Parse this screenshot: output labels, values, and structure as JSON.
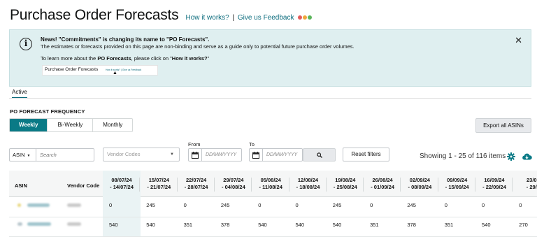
{
  "header": {
    "title": "Purchase Order Forecasts",
    "how_it_works": "How it works?",
    "separator": "|",
    "feedback": "Give us Feedback"
  },
  "alert": {
    "line1": "News! \"Commitments\" is changing its name to \"PO Forecasts\".",
    "line2": "The estimates or forecasts provided on this page are non-binding and serve as a guide only to potential future purchase order volumes.",
    "line3_prefix": "To learn more about the ",
    "line3_bold1": "PO Forecasts",
    "line3_middle": ", please click on \"",
    "line3_bold2": "How it works?",
    "line3_suffix": "\"",
    "thumb_title": "Purchase Order Forecasts",
    "thumb_links": "How it works? | Give us Feedback",
    "close_symbol": "✕"
  },
  "tabs": {
    "active": "Active"
  },
  "frequency": {
    "label": "PO FORECAST FREQUENCY",
    "options": [
      "Weekly",
      "Bi-Weekly",
      "Monthly"
    ],
    "selected": "Weekly"
  },
  "toolbar": {
    "export_label": "Export all ASINs",
    "from_label": "From",
    "to_label": "To",
    "asin_select": "ASIN",
    "search_placeholder": "Search",
    "vendor_placeholder": "Vendor Codes",
    "date_placeholder": "DD/MM/YYYY",
    "reset_label": "Reset filters",
    "showing": "Showing 1 - 25 of 116 items"
  },
  "colors": {
    "accent": "#0a7a86",
    "alert_bg": "#dfeff0",
    "link": "#0a6b7c"
  },
  "table": {
    "col_asin": "ASIN",
    "col_vendor": "Vendor Code",
    "weeks": [
      {
        "start": "08/07/24",
        "end": "- 14/07/24"
      },
      {
        "start": "15/07/24",
        "end": "- 21/07/24"
      },
      {
        "start": "22/07/24",
        "end": "- 28/07/24"
      },
      {
        "start": "29/07/24",
        "end": "- 04/08/24"
      },
      {
        "start": "05/08/24",
        "end": "- 11/08/24"
      },
      {
        "start": "12/08/24",
        "end": "- 18/08/24"
      },
      {
        "start": "19/08/24",
        "end": "- 25/08/24"
      },
      {
        "start": "26/08/24",
        "end": "- 01/09/24"
      },
      {
        "start": "02/09/24",
        "end": "- 08/09/24"
      },
      {
        "start": "09/09/24",
        "end": "- 15/09/24"
      },
      {
        "start": "16/09/24",
        "end": "- 22/09/24"
      },
      {
        "start": "23/0",
        "end": "- 29/"
      }
    ],
    "rows": [
      {
        "values": [
          "0",
          "245",
          "0",
          "245",
          "0",
          "0",
          "245",
          "0",
          "245",
          "0",
          "0",
          "0"
        ]
      },
      {
        "values": [
          "540",
          "540",
          "351",
          "378",
          "540",
          "540",
          "540",
          "351",
          "378",
          "351",
          "540",
          "270"
        ]
      }
    ]
  }
}
